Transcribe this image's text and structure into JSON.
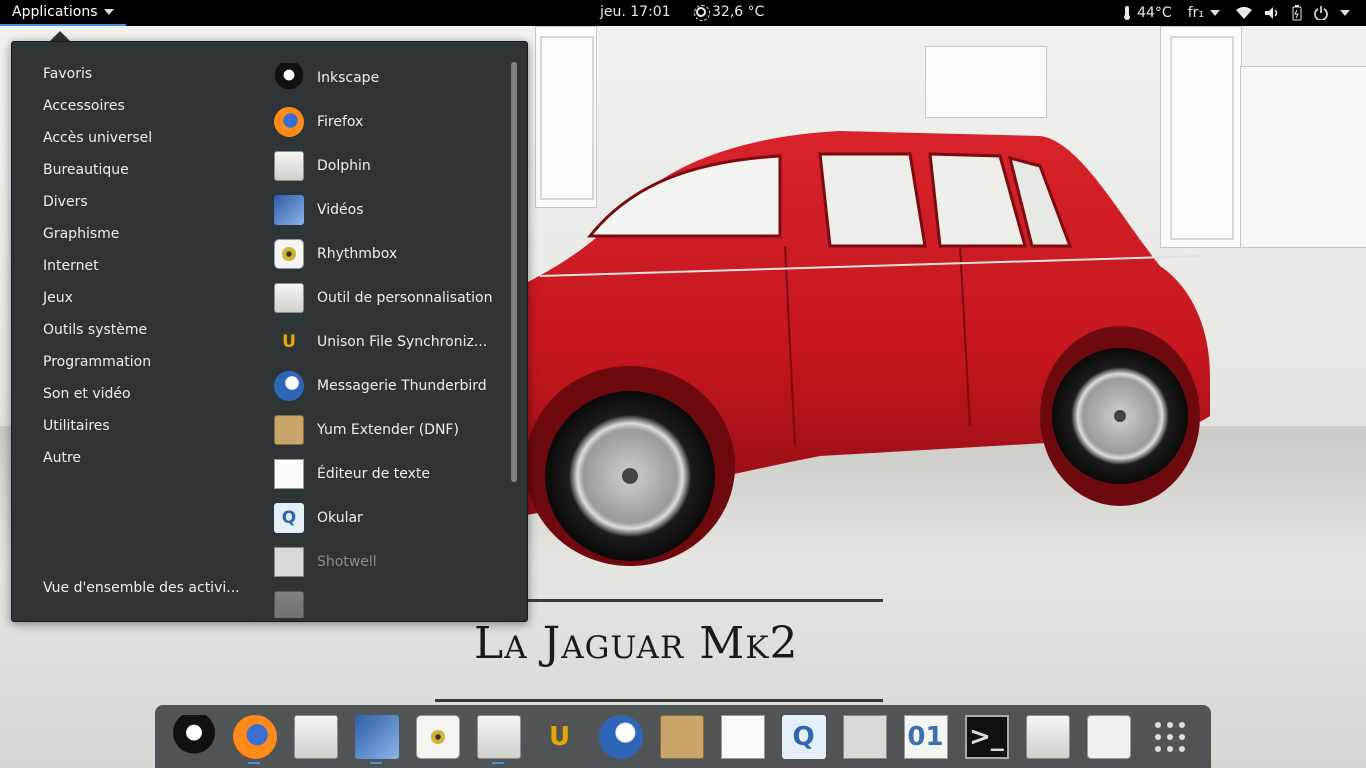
{
  "topbar": {
    "apps_label": "Applications",
    "clock": "jeu. 17:01",
    "weather": "32,6 °C",
    "temperature": "44°C",
    "keyboard": "fr₁",
    "icons": [
      "weather-sun-icon",
      "wifi-icon",
      "volume-icon",
      "battery-icon",
      "power-icon"
    ]
  },
  "menu": {
    "categories": [
      "Favoris",
      "Accessoires",
      "Accès universel",
      "Bureautique",
      "Divers",
      "Graphisme",
      "Internet",
      "Jeux",
      "Outils système",
      "Programmation",
      "Son et vidéo",
      "Utilitaires",
      "Autre"
    ],
    "overview": "Vue d'ensemble des activi...",
    "apps": [
      {
        "label": "Inkscape",
        "icon": "inkscape-icon"
      },
      {
        "label": "Firefox",
        "icon": "firefox-icon"
      },
      {
        "label": "Dolphin",
        "icon": "dolphin-icon"
      },
      {
        "label": "Vidéos",
        "icon": "videos-icon"
      },
      {
        "label": "Rhythmbox",
        "icon": "rhythmbox-icon"
      },
      {
        "label": "Outil de personnalisation",
        "icon": "tweak-tool-icon"
      },
      {
        "label": "Unison File Synchroniz...",
        "icon": "unison-icon"
      },
      {
        "label": "Messagerie Thunderbird",
        "icon": "thunderbird-icon"
      },
      {
        "label": "Yum Extender (DNF)",
        "icon": "yum-extender-icon"
      },
      {
        "label": "Éditeur de texte",
        "icon": "text-editor-icon"
      },
      {
        "label": "Okular",
        "icon": "okular-icon"
      },
      {
        "label": "Shotwell",
        "icon": "shotwell-icon"
      }
    ]
  },
  "wallpaper": {
    "headline": "La Jaguar Mk2"
  },
  "dash": {
    "items": [
      "inkscape-icon",
      "firefox-icon",
      "file-manager-icon",
      "videos-icon",
      "rhythmbox-icon",
      "tweak-tool-icon",
      "unison-icon",
      "thunderbird-icon",
      "yum-extender-icon",
      "text-editor-icon",
      "okular-icon",
      "shotwell-icon",
      "hex-editor-icon",
      "terminal-icon",
      "file-cabinet-icon",
      "software-center-icon",
      "show-apps-icon"
    ],
    "running": [
      1,
      3,
      5
    ]
  },
  "colors": {
    "accent": "#4a90d9",
    "menu_bg": "#2f3436",
    "topbar": "#000000"
  }
}
